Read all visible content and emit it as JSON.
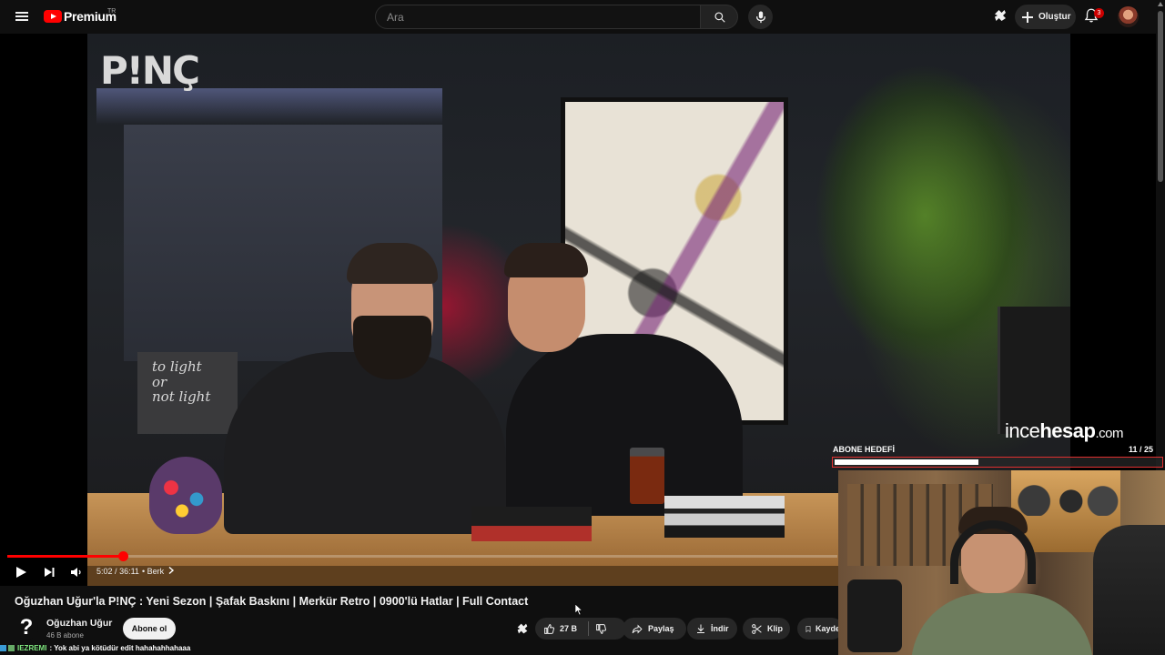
{
  "header": {
    "logo_text": "Premium",
    "region": "TR",
    "search_placeholder": "Ara",
    "create_label": "Oluştur",
    "notification_count": "3"
  },
  "player": {
    "brand_logo": "P!NÇ",
    "watermark_prefix": "ince",
    "watermark_bold": "hesap",
    "watermark_suffix": ".com",
    "time_current": "5:02",
    "time_separator": "/",
    "time_total": "36:11",
    "chapter": "Berk",
    "progress_fraction": 0.139,
    "accent_color": "#ff0000"
  },
  "overlay": {
    "goal_label": "ABONE HEDEFİ",
    "goal_count": "11 / 25",
    "goal_fraction": 0.44
  },
  "video": {
    "title": "Oğuzhan Uğur'la P!NÇ : Yeni Sezon | Şafak Baskını | Merkür Retro | 0900'lü Hatlar | Full Contact",
    "channel_name": "Oğuzhan Uğur",
    "channel_avatar": "?",
    "subscribers": "46 B abone",
    "subscribe_label": "Abone ol",
    "likes": "27 B",
    "share_label": "Paylaş",
    "download_label": "İndir",
    "clip_label": "Klip",
    "save_label": "Kaydet"
  },
  "chat": {
    "user": "IEZREMI",
    "message": ": Yok abi ya kötüdür edit hahahahhahaaa"
  },
  "icons": [
    "menu-icon",
    "youtube-logo-icon",
    "search-icon",
    "mic-icon",
    "extension-icon",
    "plus-icon",
    "bell-icon",
    "play-icon",
    "next-icon",
    "volume-icon",
    "chevron-right-icon",
    "like-icon",
    "dislike-icon",
    "share-icon",
    "download-icon",
    "clip-icon",
    "save-icon"
  ]
}
